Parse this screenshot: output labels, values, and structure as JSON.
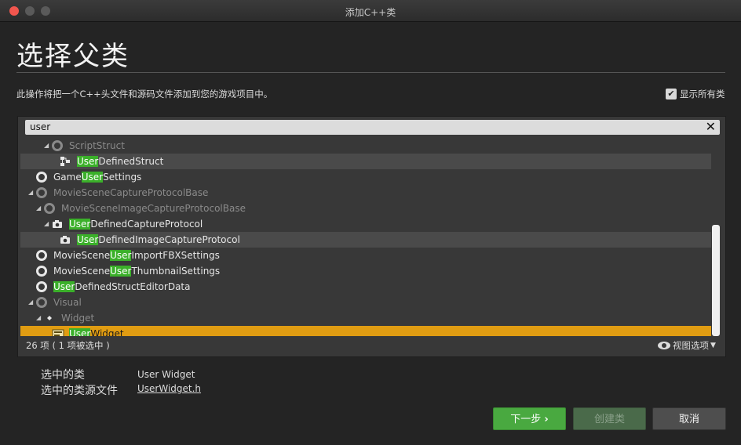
{
  "window": {
    "title": "添加C++类"
  },
  "heading": "选择父类",
  "description": "此操作将把一个C++头文件和源码文件添加到您的游戏项目中。",
  "show_all": {
    "label": "显示所有类",
    "checked": true,
    "check_glyph": "✔"
  },
  "search": {
    "value": "user",
    "clear_glyph": "✕"
  },
  "tree": {
    "rows": [
      {
        "pre": "",
        "hl": "",
        "post": "ScriptStruct",
        "icon": "circle-icon",
        "dim": true
      },
      {
        "pre": "",
        "hl": "User",
        "post": "DefinedStruct",
        "icon": "struct-icon",
        "dim": false
      },
      {
        "pre": "Game",
        "hl": "User",
        "post": "Settings",
        "icon": "circle-icon",
        "dim": false
      },
      {
        "pre": "",
        "hl": "",
        "post": "MovieSceneCaptureProtocolBase",
        "icon": "circle-icon",
        "dim": true
      },
      {
        "pre": "",
        "hl": "",
        "post": "MovieSceneImageCaptureProtocolBase",
        "icon": "circle-icon",
        "dim": true
      },
      {
        "pre": "",
        "hl": "User",
        "post": "DefinedCaptureProtocol",
        "icon": "camera-icon",
        "dim": false
      },
      {
        "pre": "",
        "hl": "User",
        "post": "DefinedImageCaptureProtocol",
        "icon": "camera-icon",
        "dim": false
      },
      {
        "pre": "MovieScene",
        "hl": "User",
        "post": "ImportFBXSettings",
        "icon": "circle-icon",
        "dim": false
      },
      {
        "pre": "MovieScene",
        "hl": "User",
        "post": "ThumbnailSettings",
        "icon": "circle-icon",
        "dim": false
      },
      {
        "pre": "",
        "hl": "User",
        "post": "DefinedStructEditorData",
        "icon": "circle-icon",
        "dim": false
      },
      {
        "pre": "",
        "hl": "",
        "post": "Visual",
        "icon": "circle-icon",
        "dim": true
      },
      {
        "pre": "",
        "hl": "",
        "post": "Widget",
        "icon": "diamond-icon",
        "dim": true
      },
      {
        "pre": "",
        "hl": "User",
        "post": "Widget",
        "icon": "widget-icon",
        "dim": false,
        "selected": true
      }
    ]
  },
  "footer": {
    "count": "26 项 ( 1 项被选中 )",
    "view_options": "视图选项"
  },
  "selection": {
    "class_label": "选中的类",
    "class_value": "User Widget",
    "source_label": "选中的类源文件",
    "source_value": "UserWidget.h"
  },
  "buttons": {
    "next": "下一步",
    "create": "创建类",
    "cancel": "取消"
  },
  "colors": {
    "highlight": "#3bb02a",
    "selected_row": "#e09c12",
    "next_button": "#49a940"
  }
}
